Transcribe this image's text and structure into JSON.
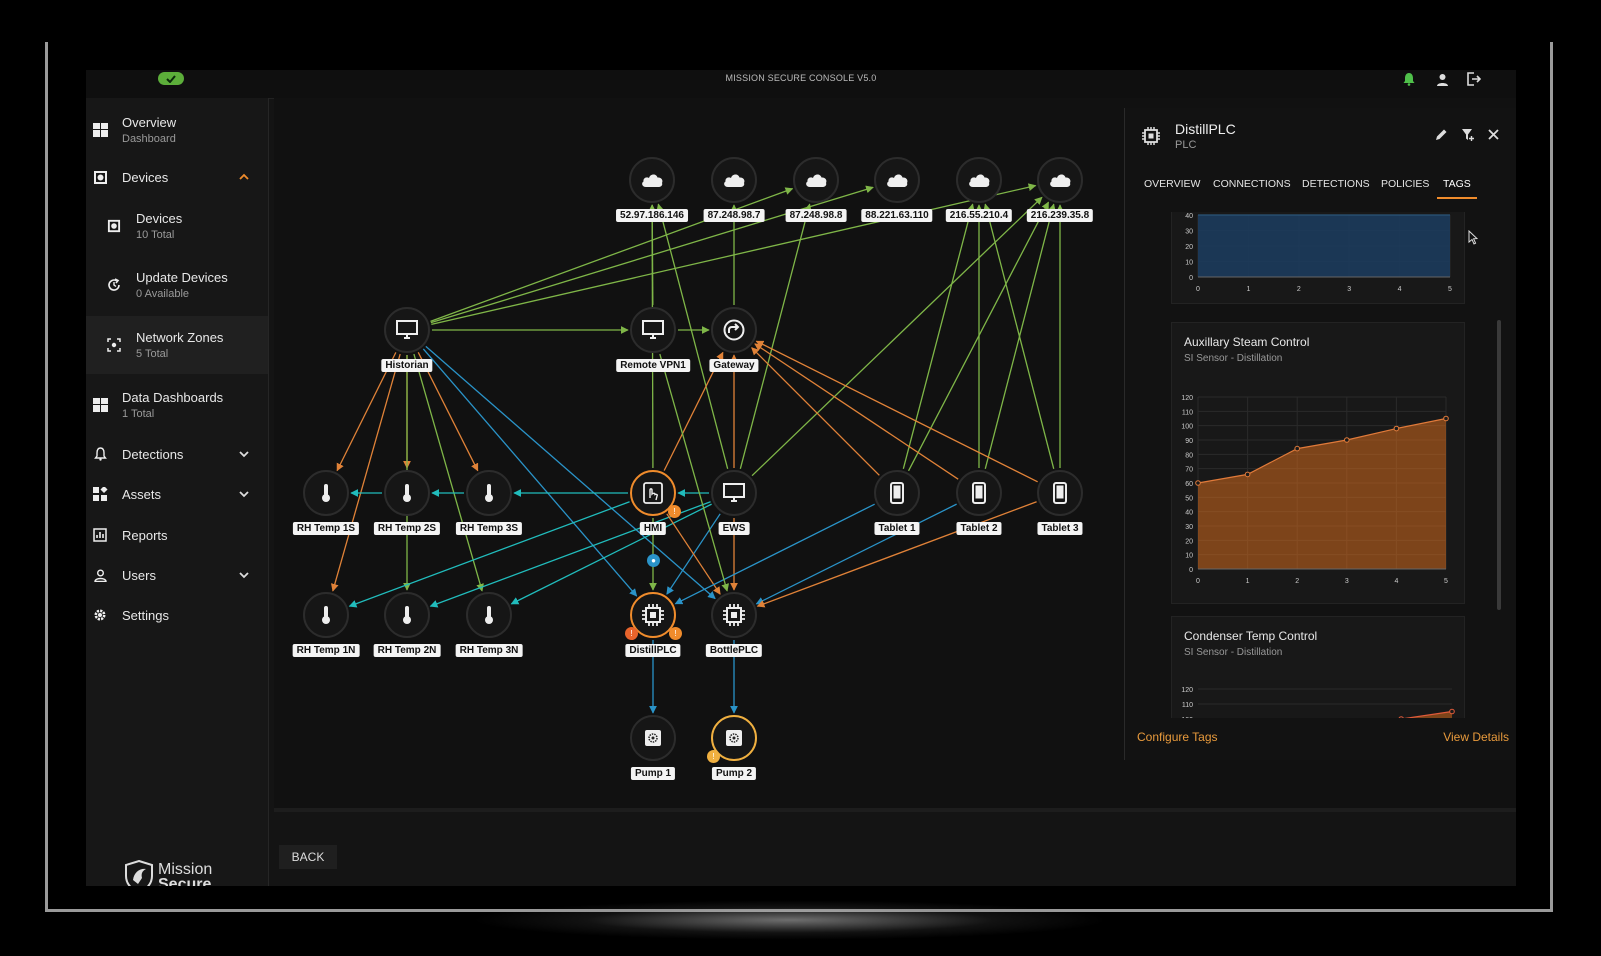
{
  "app": {
    "title": "MISSION SECURE CONSOLE V5.0",
    "brand_line1": "Mission",
    "brand_line2": "Secure",
    "back_label": "BACK",
    "colors": {
      "accent": "#f08c2c",
      "ok": "#5cae3a",
      "link_green": "#8bc34a",
      "link_blue": "#29a3d6",
      "link_teal": "#22c4c4"
    }
  },
  "topbar": {
    "icons": [
      "alarm-bell-icon",
      "user-icon",
      "logout-icon"
    ]
  },
  "sidebar": {
    "items": [
      {
        "label": "Overview",
        "sub": "Dashboard",
        "icon": "dashboard-icon"
      },
      {
        "label": "Devices",
        "sub": "",
        "icon": "devices-icon",
        "expanded": true
      },
      {
        "label": "Devices",
        "sub": "10 Total",
        "icon": "devices-icon"
      },
      {
        "label": "Update Devices",
        "sub": "0 Available",
        "icon": "update-icon"
      },
      {
        "label": "Network Zones",
        "sub": "5 Total",
        "icon": "zones-icon"
      },
      {
        "label": "Data Dashboards",
        "sub": "1 Total",
        "icon": "dashboard-icon"
      },
      {
        "label": "Detections",
        "sub": "",
        "icon": "bell-icon"
      },
      {
        "label": "Assets",
        "sub": "",
        "icon": "assets-icon"
      },
      {
        "label": "Reports",
        "sub": "",
        "icon": "reports-icon"
      },
      {
        "label": "Users",
        "sub": "",
        "icon": "user-icon"
      },
      {
        "label": "Settings",
        "sub": "",
        "icon": "gear-icon"
      }
    ]
  },
  "graph": {
    "nodes": [
      {
        "id": "c1",
        "label": "52.97.186.146",
        "icon": "cloud"
      },
      {
        "id": "c2",
        "label": "87.248.98.7",
        "icon": "cloud"
      },
      {
        "id": "c3",
        "label": "87.248.98.8",
        "icon": "cloud"
      },
      {
        "id": "c4",
        "label": "88.221.63.110",
        "icon": "cloud"
      },
      {
        "id": "c5",
        "label": "216.55.210.4",
        "icon": "cloud"
      },
      {
        "id": "c6",
        "label": "216.239.35.8",
        "icon": "cloud"
      },
      {
        "id": "historian",
        "label": "Historian",
        "icon": "monitor"
      },
      {
        "id": "vpn",
        "label": "Remote VPN1",
        "icon": "monitor"
      },
      {
        "id": "gateway",
        "label": "Gateway",
        "icon": "gateway"
      },
      {
        "id": "t1s",
        "label": "RH Temp 1S",
        "icon": "thermo"
      },
      {
        "id": "t2s",
        "label": "RH Temp 2S",
        "icon": "thermo"
      },
      {
        "id": "t3s",
        "label": "RH Temp 3S",
        "icon": "thermo"
      },
      {
        "id": "hmi",
        "label": "HMI",
        "icon": "hmi"
      },
      {
        "id": "ews",
        "label": "EWS",
        "icon": "monitor"
      },
      {
        "id": "tab1",
        "label": "Tablet 1",
        "icon": "tablet"
      },
      {
        "id": "tab2",
        "label": "Tablet 2",
        "icon": "tablet"
      },
      {
        "id": "tab3",
        "label": "Tablet 3",
        "icon": "tablet"
      },
      {
        "id": "t1n",
        "label": "RH Temp 1N",
        "icon": "thermo"
      },
      {
        "id": "t2n",
        "label": "RH Temp 2N",
        "icon": "thermo"
      },
      {
        "id": "t3n",
        "label": "RH Temp 3N",
        "icon": "thermo"
      },
      {
        "id": "distill",
        "label": "DistillPLC",
        "icon": "chip"
      },
      {
        "id": "bottle",
        "label": "BottlePLC",
        "icon": "chip"
      },
      {
        "id": "pump1",
        "label": "Pump 1",
        "icon": "pump"
      },
      {
        "id": "pump2",
        "label": "Pump 2",
        "icon": "pump"
      }
    ]
  },
  "panel": {
    "title": "DistillPLC",
    "subtitle": "PLC",
    "tabs": [
      "OVERVIEW",
      "CONNECTIONS",
      "DETECTIONS",
      "POLICIES",
      "TAGS"
    ],
    "active_tab": "TAGS",
    "configure_label": "Configure Tags",
    "view_details_label": "View Details",
    "cards": [
      {
        "title": "",
        "subtitle": ""
      },
      {
        "title": "Auxillary Steam Control",
        "subtitle": "SI Sensor - Distillation"
      },
      {
        "title": "Condenser Temp Control",
        "subtitle": "SI Sensor - Distillation"
      }
    ]
  },
  "chart_data": [
    {
      "type": "area",
      "title": "",
      "x": [
        0,
        1,
        2,
        3,
        4,
        5
      ],
      "xticks": [
        0,
        1,
        2,
        3,
        4,
        5
      ],
      "yticks": [
        0,
        10,
        20,
        30,
        40
      ],
      "ylim": [
        0,
        40
      ],
      "grid": true,
      "series": [
        {
          "values": [
            40,
            40,
            40,
            40,
            40,
            40
          ],
          "color": "#1c3b5c"
        }
      ]
    },
    {
      "type": "area",
      "title": "Auxillary Steam Control",
      "x": [
        0,
        1,
        2,
        3,
        4,
        5
      ],
      "xticks": [
        0,
        1,
        2,
        3,
        4,
        5
      ],
      "yticks": [
        0,
        10,
        20,
        30,
        40,
        50,
        60,
        70,
        80,
        90,
        100,
        110,
        120
      ],
      "ylim": [
        0,
        120
      ],
      "grid": true,
      "series": [
        {
          "values": [
            60,
            66,
            84,
            90,
            98,
            105
          ],
          "color": "#d2691e"
        }
      ]
    },
    {
      "type": "area",
      "title": "Condenser Temp Control",
      "x": [
        4,
        5
      ],
      "yticks": [
        100,
        110,
        120
      ],
      "ylim": [
        100,
        120
      ],
      "grid": true,
      "series": [
        {
          "values": [
            100,
            105
          ],
          "color": "#d2691e"
        }
      ]
    }
  ]
}
